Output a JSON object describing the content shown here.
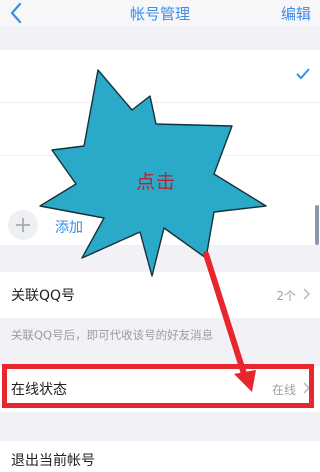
{
  "header": {
    "title": "帐号管理",
    "edit_label": "编辑",
    "back_icon": "chevron-left-icon"
  },
  "accounts": {
    "add_label": "添加"
  },
  "qq_link": {
    "label": "关联QQ号",
    "value": "2个",
    "hint": "关联QQ号后，即可代收该号的好友消息"
  },
  "online_status": {
    "label": "在线状态",
    "value": "在线"
  },
  "logout": {
    "label": "退出当前帐号"
  },
  "annotation": {
    "burst_text": "点击"
  },
  "colors": {
    "accent": "#3a8de8",
    "highlight": "#e8262e",
    "burst": "#2aa9c9",
    "burst_text": "#c0222a"
  }
}
